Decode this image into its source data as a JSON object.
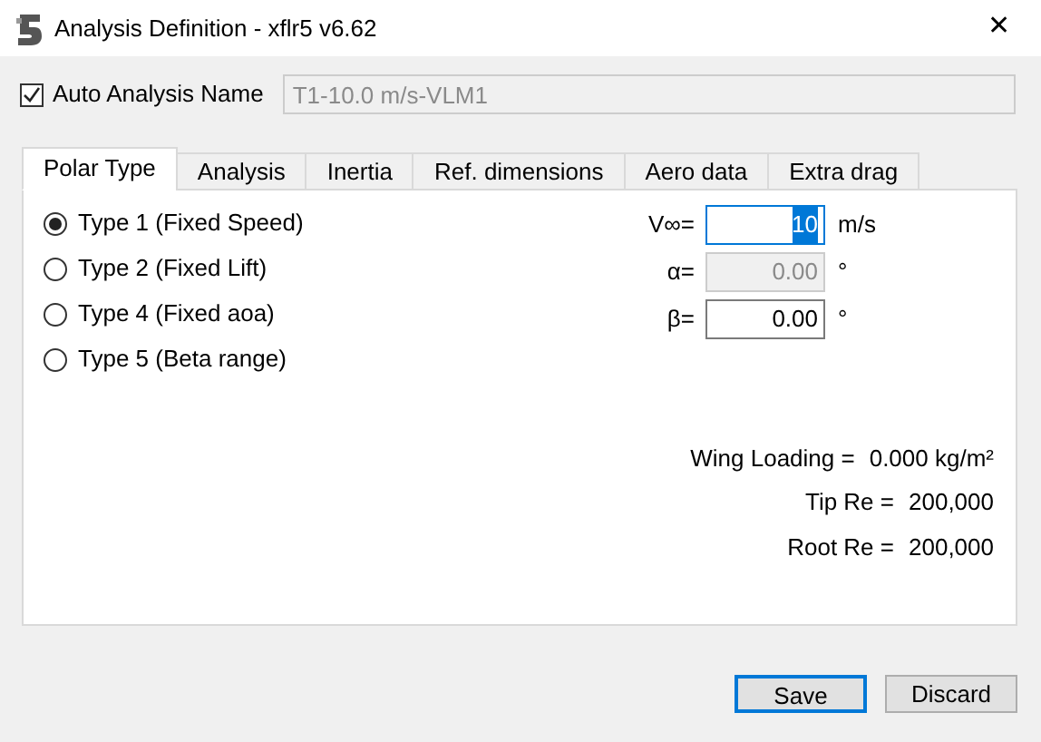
{
  "window": {
    "title": "Analysis Definition - xflr5 v6.62",
    "close": "✕"
  },
  "auto_name": {
    "label": "Auto Analysis Name",
    "checked": true,
    "value": "T1-10.0 m/s-VLM1",
    "disabled": true
  },
  "tabs": [
    {
      "label": "Polar Type",
      "selected": true
    },
    {
      "label": "Analysis",
      "selected": false
    },
    {
      "label": "Inertia",
      "selected": false
    },
    {
      "label": "Ref. dimensions",
      "selected": false
    },
    {
      "label": "Aero data",
      "selected": false
    },
    {
      "label": "Extra drag",
      "selected": false
    }
  ],
  "polar_types": [
    {
      "label": "Type 1 (Fixed Speed)",
      "selected": true
    },
    {
      "label": "Type 2 (Fixed Lift)",
      "selected": false
    },
    {
      "label": "Type 4 (Fixed aoa)",
      "selected": false
    },
    {
      "label": "Type 5 (Beta range)",
      "selected": false
    }
  ],
  "fields": [
    {
      "label": "V∞=",
      "value": "10",
      "unit": "m/s",
      "disabled": false,
      "focused": true
    },
    {
      "label": "α=",
      "value": "0.00",
      "unit": "°",
      "disabled": true,
      "focused": false
    },
    {
      "label": "β=",
      "value": "0.00",
      "unit": "°",
      "disabled": false,
      "focused": false
    }
  ],
  "info": [
    {
      "label": "Wing Loading =",
      "value": "0.000 kg/m²"
    },
    {
      "label": "Tip Re =",
      "value": "200,000"
    },
    {
      "label": "Root Re =",
      "value": "200,000"
    }
  ],
  "buttons": [
    {
      "label": "Save",
      "default": true
    },
    {
      "label": "Discard",
      "default": false
    }
  ]
}
